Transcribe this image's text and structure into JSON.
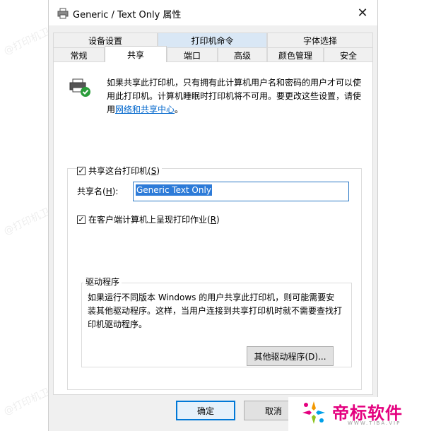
{
  "window": {
    "title": "Generic / Text Only 属性",
    "close_glyph": "✕"
  },
  "tabs": {
    "row1": [
      {
        "label": "设备设置"
      },
      {
        "label": "打印机命令"
      },
      {
        "label": "字体选择"
      }
    ],
    "row2": [
      {
        "label": "常规"
      },
      {
        "label": "共享"
      },
      {
        "label": "端口"
      },
      {
        "label": "高级"
      },
      {
        "label": "颜色管理"
      },
      {
        "label": "安全"
      }
    ],
    "active": "共享"
  },
  "sharing": {
    "info_text": "如果共享此打印机，只有拥有此计算机用户名和密码的用户才可以使用此打印机。计算机睡眠时打印机将不可用。要更改这些设置，请使用",
    "info_link": "网络和共享中心",
    "info_end": "。",
    "share_checkbox": {
      "label": "共享这台打印机(",
      "key": "S",
      "label_end": ")",
      "checked": true
    },
    "share_name_label": "共享名(",
    "share_name_key": "H",
    "share_name_end": "):",
    "share_name_value": "Generic  Text Only",
    "render_checkbox": {
      "label": "在客户端计算机上呈现打印作业(",
      "key": "R",
      "label_end": ")",
      "checked": true
    },
    "check_glyph": "✓"
  },
  "drivers": {
    "title": "驱动程序",
    "text": "如果运行不同版本 Windows 的用户共享此打印机，则可能需要安装其他驱动程序。这样，当用户连接到共享打印机时就不需要查找打印机驱动程序。",
    "button_label": "其他驱动程序(D)..."
  },
  "footer": {
    "ok_label": "确定",
    "cancel_label": "取消"
  },
  "watermark": {
    "text": "@打印机卫士"
  },
  "logo": {
    "text": "帝标软件",
    "sub": "WWW.TIBA.VIP",
    "color": "#e4007f"
  }
}
